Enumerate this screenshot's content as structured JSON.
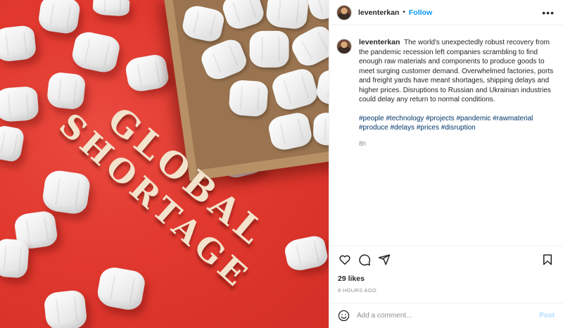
{
  "photo": {
    "headline_line1": "GLOBAL",
    "headline_line2": "SHORTAGE",
    "background_color": "#e23a30"
  },
  "header": {
    "username": "leventerkan",
    "separator": "•",
    "follow_label": "Follow",
    "more_icon": "more-horizontal-icon"
  },
  "caption": {
    "username": "leventerkan",
    "text": "The world's unexpectedly robust recovery from the pandemic recession left companies scrambling to find enough raw materials and components to produce goods to meet surging customer demand. Overwhelmed factories, ports and freight yards have meant shortages, shipping delays and higher prices. Disruptions to Russian and Ukrainian industries could delay any return to normal conditions.",
    "hashtags": [
      "#people",
      "#technology",
      "#projects",
      "#pandemic",
      "#rawmaterial",
      "#produce",
      "#delays",
      "#prices",
      "#disruption"
    ],
    "time": "8h"
  },
  "actions": {
    "icons": [
      "heart-icon",
      "comment-icon",
      "share-icon",
      "bookmark-icon"
    ],
    "likes": "29 likes",
    "post_time": "8 HOURS AGO"
  },
  "comment_box": {
    "emoji_icon": "emoji-icon",
    "placeholder": "Add a comment...",
    "post_label": "Post"
  },
  "colors": {
    "accent": "#0095f6",
    "hashtag": "#00376b",
    "post_disabled": "#b3dbff",
    "muted": "#8e8e8e"
  }
}
